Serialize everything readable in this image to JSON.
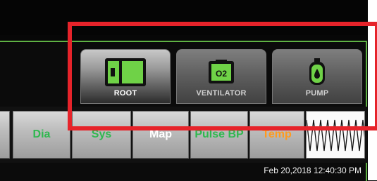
{
  "tabs": [
    {
      "label": "ROOT",
      "icon": "root-panel-icon",
      "active": true
    },
    {
      "label": "VENTILATOR",
      "icon": "o2-ventilator-icon",
      "active": false
    },
    {
      "label": "PUMP",
      "icon": "infusion-pump-icon",
      "active": false
    }
  ],
  "vent_icon_text": "O2",
  "params": [
    {
      "label": "Dia",
      "color": "#2fb84f"
    },
    {
      "label": "Sys",
      "color": "#2fb84f"
    },
    {
      "label": "Map",
      "color": "#ffffff"
    },
    {
      "label": "Pulse BP",
      "color": "#2fb84f"
    },
    {
      "label": "Temp",
      "color": "#ff9a1f"
    }
  ],
  "timestamp": "Feb 20,2018 12:40:30 PM",
  "colors": {
    "accent_green": "#5fb244",
    "highlight_red": "#e6232a"
  }
}
